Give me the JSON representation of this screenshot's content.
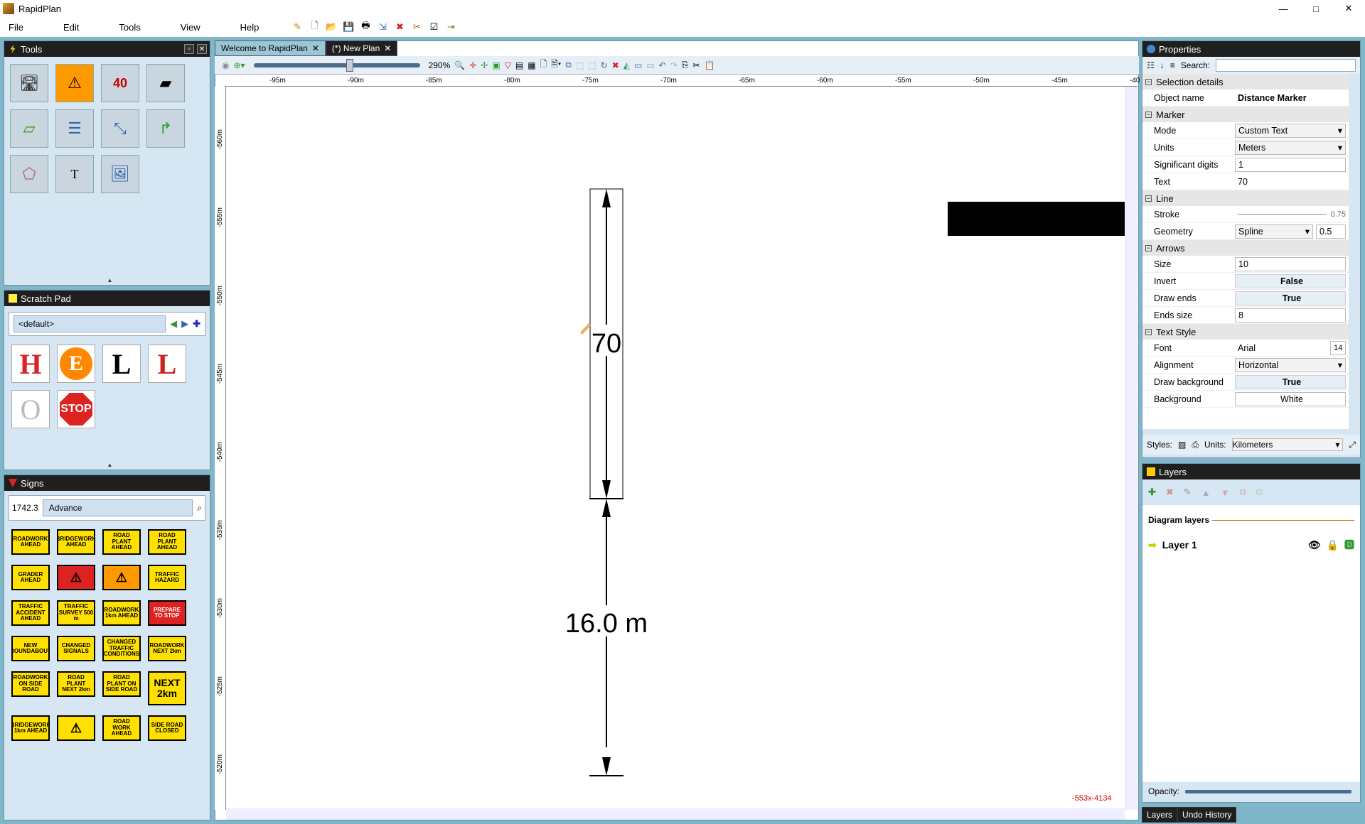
{
  "app": {
    "title": "RapidPlan"
  },
  "window_controls": [
    "—",
    "□",
    "✕"
  ],
  "menu": [
    "File",
    "Edit",
    "Tools",
    "View",
    "Help"
  ],
  "panels": {
    "tools": {
      "title": "Tools"
    },
    "scratch": {
      "title": "Scratch Pad",
      "combo": "<default>"
    },
    "signs": {
      "title": "Signs",
      "count": "1742.3",
      "combo": "Advance"
    }
  },
  "signs": [
    "ROADWORK AHEAD",
    "BRIDGEWORK AHEAD",
    "ROAD PLANT AHEAD",
    "ROAD PLANT AHEAD",
    "GRADER AHEAD",
    "",
    "",
    "TRAFFIC HAZARD",
    "TRAFFIC ACCIDENT AHEAD",
    "TRAFFIC SURVEY 500 m",
    "ROADWORK 1km AHEAD",
    "PREPARE TO STOP",
    "NEW ROUNDABOUT",
    "CHANGED SIGNALS",
    "CHANGED TRAFFIC CONDITIONS",
    "ROADWORK NEXT 2km",
    "ROADWORK ON SIDE ROAD",
    "ROAD PLANT NEXT 2km",
    "ROAD PLANT ON SIDE ROAD",
    "NEXT 2km",
    "BRIDGEWORK 1km AHEAD",
    "",
    "ROAD WORK AHEAD",
    "SIDE ROAD CLOSED"
  ],
  "tabs": [
    {
      "label": "Welcome to RapidPlan"
    },
    {
      "label": "(*) New Plan"
    }
  ],
  "zoom": "290%",
  "ruler_h": [
    "-95m",
    "-90m",
    "-85m",
    "-80m",
    "-75m",
    "-70m",
    "-65m",
    "-60m",
    "-55m",
    "-50m",
    "-45m",
    "-40"
  ],
  "ruler_v": [
    "-560m",
    "-555m",
    "-550m",
    "-545m",
    "-540m",
    "-535m",
    "-530m",
    "-525m",
    "-520m"
  ],
  "canvas": {
    "marker_text": "70",
    "distance_label": "16.0 m",
    "coords": "-553x-4134"
  },
  "properties": {
    "title": "Properties",
    "search_label": "Search:",
    "cats": {
      "selection": "Selection details",
      "marker": "Marker",
      "line": "Line",
      "arrows": "Arrows",
      "text_style": "Text Style"
    },
    "object_name_label": "Object name",
    "object_name": "Distance Marker",
    "mode_label": "Mode",
    "mode": "Custom Text",
    "units_label": "Units",
    "units": "Meters",
    "sig_label": "Significant digits",
    "sig": "1",
    "text_label": "Text",
    "text": "70",
    "stroke_label": "Stroke",
    "stroke": "0.75",
    "geometry_label": "Geometry",
    "geometry": "Spline",
    "geometry_val": "0.5",
    "size_label": "Size",
    "size": "10",
    "invert_label": "Invert",
    "invert": "False",
    "draw_ends_label": "Draw ends",
    "draw_ends": "True",
    "ends_size_label": "Ends size",
    "ends_size": "8",
    "font_label": "Font",
    "font": "Arial",
    "font_size": "14",
    "align_label": "Alignment",
    "align": "Horizontal",
    "draw_bg_label": "Draw background",
    "draw_bg": "True",
    "bg_label": "Background",
    "bg": "White",
    "styles_label": "Styles:",
    "units2_label": "Units:",
    "units2": "Kilometers"
  },
  "layers": {
    "title": "Layers",
    "section": "Diagram layers",
    "layer1": "Layer 1",
    "opacity_label": "Opacity:",
    "opacity": 1.0
  },
  "bottom_tabs": [
    "Layers",
    "Undo History"
  ]
}
